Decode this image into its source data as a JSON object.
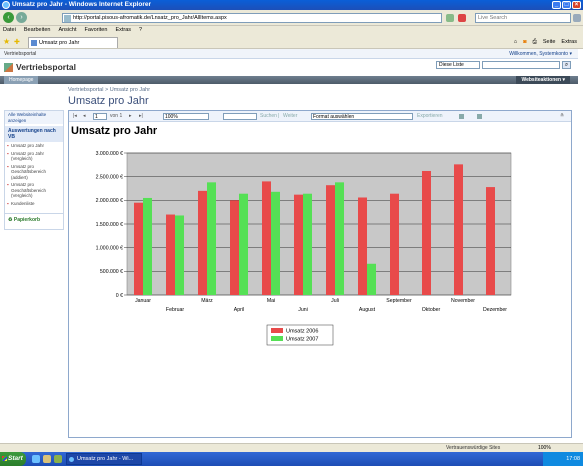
{
  "window": {
    "title": "Umsatz pro Jahr - Windows Internet Explorer"
  },
  "address": {
    "url": "http://portal.pisous-afromatik.de/Lnsatz_pro_Jahr/AllItems.aspx",
    "search_placeholder": "Live Search"
  },
  "menu": [
    "Datei",
    "Bearbeiten",
    "Ansicht",
    "Favoriten",
    "Extras",
    "?"
  ],
  "browser_tab": {
    "label": "Umsatz pro Jahr"
  },
  "command_bar": {
    "page": "Seite",
    "tools": "Extras"
  },
  "sharepoint": {
    "top_link": "Vertriebsportal",
    "welcome": "Willkommen, Systemkonto ▾",
    "logo": "Vertriebsportal",
    "search_scope": "Diese Liste",
    "homepage_tab": "Homepage",
    "site_actions": "Websiteaktionen ▾",
    "breadcrumb": "Vertriebsportal > Umsatz pro Jahr",
    "page_title": "Umsatz pro Jahr"
  },
  "leftnav": {
    "view_all": "Alle Websiteinhalte anzeigen",
    "heading": "Auswertungen nach VB",
    "items": [
      "Umsatz pro Jahr",
      "Umsatz pro Jahr (Vergleich)",
      "Umsatz pro Geschäftsbereich (addiert)",
      "Umsatz pro Geschäftsbereich (Vergleich)",
      "Kundenliste"
    ],
    "recycle": "Papierkorb"
  },
  "toolbar": {
    "page_value": "1",
    "of_label": "von 1",
    "zoom": "100%",
    "find_label": "Suchen",
    "separator": "|",
    "next_label": "Weiter",
    "format": "Format auswählen",
    "export": "Exportieren"
  },
  "report": {
    "title": "Umsatz pro Jahr"
  },
  "chart_data": {
    "type": "bar",
    "title": "Umsatz pro Jahr",
    "categories": [
      "Januar",
      "Februar",
      "März",
      "April",
      "Mai",
      "Juni",
      "Juli",
      "August",
      "September",
      "Oktober",
      "November",
      "Dezember"
    ],
    "series": [
      {
        "name": "Umsatz 2006",
        "color": "#e84a4a",
        "values": [
          1950000,
          1700000,
          2200000,
          2000000,
          2400000,
          2120000,
          2320000,
          2060000,
          2140000,
          2620000,
          2760000,
          2280000
        ]
      },
      {
        "name": "Umsatz 2007",
        "color": "#55e055",
        "values": [
          2050000,
          1680000,
          2380000,
          2140000,
          2180000,
          2140000,
          2380000,
          660000,
          null,
          null,
          null,
          null
        ]
      }
    ],
    "yticks": [
      "0 €",
      "500.000 €",
      "1.000.000 €",
      "1.500.000 €",
      "2.000.000 €",
      "2.500.000 €",
      "3.000.000 €"
    ],
    "ylim": [
      0,
      3000000
    ],
    "grid": true,
    "legend": "bottom-center",
    "plot_bg": "#c8c8c8"
  },
  "status": {
    "zone": "Vertrauenswürdige Sites",
    "zoom": "100%"
  },
  "taskbar": {
    "start": "Start",
    "task": "Umsatz pro Jahr - Wi...",
    "clock": "17:08"
  }
}
